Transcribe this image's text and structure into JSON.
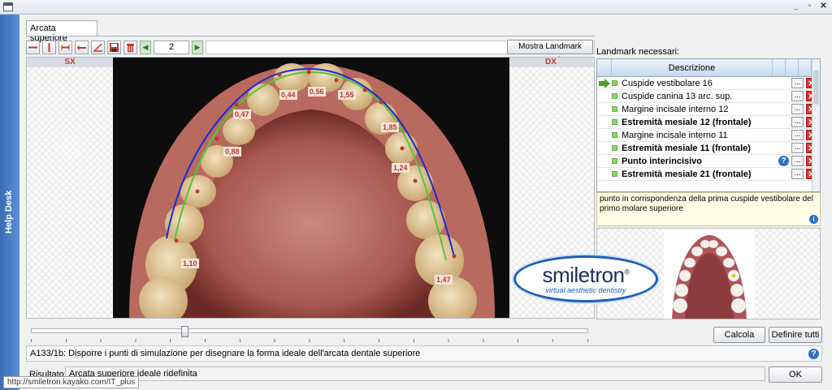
{
  "window": {
    "controls": [
      "_",
      "▫",
      "✕"
    ]
  },
  "helpdesk": {
    "label": "Help Desk"
  },
  "tab": {
    "label": "Arcata superiore"
  },
  "toolbar": {
    "page_value": "2",
    "landmark_button": "Mostra Landmark corrente"
  },
  "viewer": {
    "left_header": "SX",
    "right_header": "DX",
    "measurements": [
      "0,44",
      "0,56",
      "1,55",
      "0,47",
      "1,85",
      "0,88",
      "1,24",
      "1,10",
      "1,47"
    ]
  },
  "slider": {
    "value_fraction": 0.27
  },
  "landmarks": {
    "label": "Landmark necessari:",
    "column_header": "Descrizione",
    "rows": [
      {
        "text": "Cuspide vestibolare 16",
        "bold": false,
        "current": true
      },
      {
        "text": "Cuspide canina 13 arc. sup.",
        "bold": false,
        "current": false
      },
      {
        "text": "Margine incisale interno 12",
        "bold": false,
        "current": false
      },
      {
        "text": "Estremità mesiale 12 (frontale)",
        "bold": true,
        "current": false
      },
      {
        "text": "Margine incisale interno 11",
        "bold": false,
        "current": false
      },
      {
        "text": "Estremità mesiale 11 (frontale)",
        "bold": true,
        "current": false
      },
      {
        "text": "Punto interincisivo",
        "bold": true,
        "current": false,
        "help": true
      },
      {
        "text": "Estremità mesiale 21 (frontale)",
        "bold": true,
        "current": false
      }
    ],
    "row_button_label": "...",
    "description": "punto in corrispondenza della prima cuspide vestibolare del primo molare superiore"
  },
  "logo": {
    "name": "smiletron",
    "registered": "®",
    "tagline": "virtual aesthetic dentistry"
  },
  "buttons": {
    "calcola": "Calcola",
    "definire": "Definire tutti",
    "ok": "OK"
  },
  "instruction": "A133/1b: Disporre i punti di simulazione per disegnare la forma ideale dell'arcata dentale superiore",
  "result": {
    "label": "Risultato:",
    "value": "Arcata superiore ideale ridefinita"
  },
  "status_url": "http://smiletron.kayako.com/IT_plus",
  "colors": {
    "ideal_arch": "#1a2ad0",
    "current_arch": "#55c43a",
    "measure": "#c0392b"
  }
}
